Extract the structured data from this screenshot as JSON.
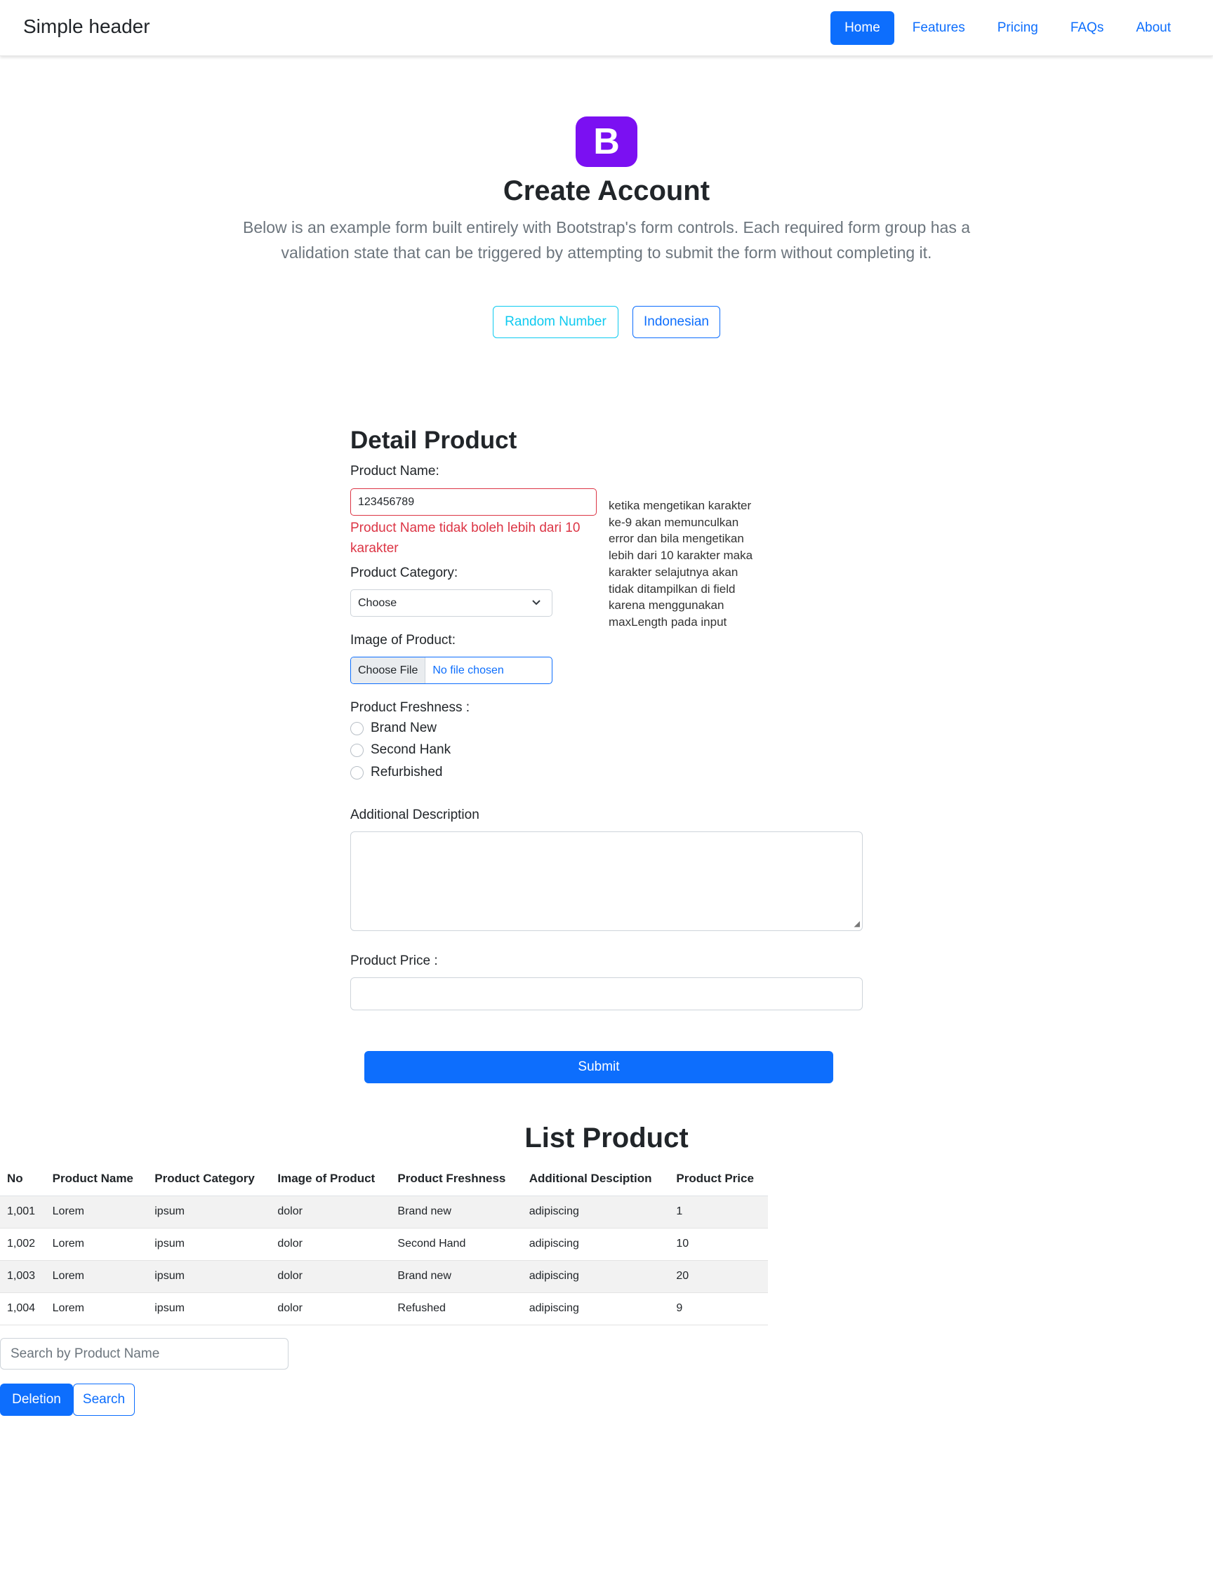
{
  "header": {
    "brand": "Simple header",
    "nav": [
      {
        "label": "Home",
        "active": true
      },
      {
        "label": "Features"
      },
      {
        "label": "Pricing"
      },
      {
        "label": "FAQs"
      },
      {
        "label": "About"
      }
    ]
  },
  "hero": {
    "logo_letter": "B",
    "title": "Create Account",
    "lead": "Below is an example form built entirely with Bootstrap's form controls. Each required form group has a validation state that can be triggered by attempting to submit the form without completing it.",
    "random_button": "Random Number",
    "language_button": "Indonesian"
  },
  "form": {
    "title": "Detail Product",
    "product_name_label": "Product Name:",
    "product_name_value": "123456789",
    "product_name_error": "Product Name tidak boleh lebih dari 10 karakter",
    "note": "ketika mengetikan karakter ke-9 akan memunculkan error dan bila mengetikan lebih dari 10 karakter maka karakter selajutnya akan tidak ditampilkan di field karena menggunakan maxLength pada input",
    "category_label": "Product Category:",
    "category_value": "Choose",
    "image_label": "Image of Product:",
    "file_button": "Choose File",
    "file_status": "No file chosen",
    "freshness_label": "Product Freshness :",
    "freshness_options": [
      "Brand New",
      "Second Hank",
      "Refurbished"
    ],
    "description_label": "Additional Description",
    "price_label": "Product Price :",
    "submit_label": "Submit"
  },
  "list": {
    "title": "List Product",
    "columns": [
      "No",
      "Product Name",
      "Product Category",
      "Image of Product",
      "Product Freshness",
      "Additional Desciption",
      "Product Price"
    ],
    "rows": [
      [
        "1,001",
        "Lorem",
        "ipsum",
        "dolor",
        "Brand new",
        "adipiscing",
        "1"
      ],
      [
        "1,002",
        "Lorem",
        "ipsum",
        "dolor",
        "Second Hand",
        "adipiscing",
        "10"
      ],
      [
        "1,003",
        "Lorem",
        "ipsum",
        "dolor",
        "Brand new",
        "adipiscing",
        "20"
      ],
      [
        "1,004",
        "Lorem",
        "ipsum",
        "dolor",
        "Refushed",
        "adipiscing",
        "9"
      ]
    ],
    "search_placeholder": "Search by Product Name",
    "delete_label": "Deletion",
    "search_label": "Search"
  }
}
